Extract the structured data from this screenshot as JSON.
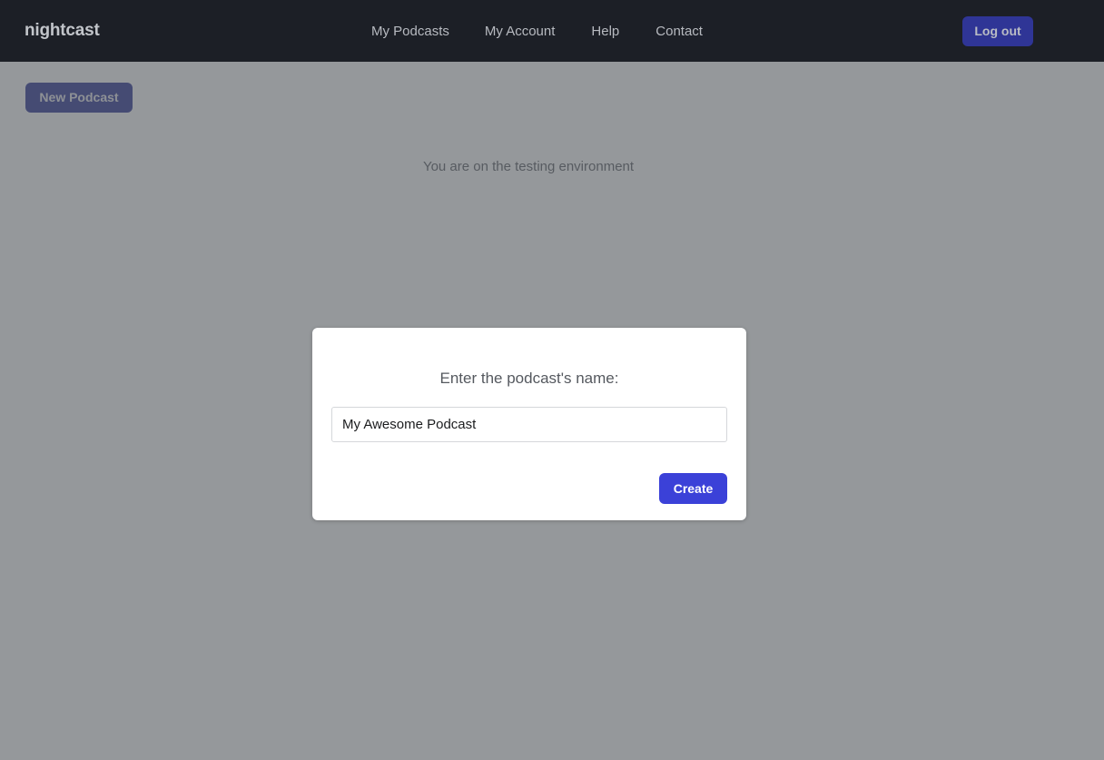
{
  "header": {
    "brand": "nightcast",
    "nav": [
      {
        "label": "My Podcasts"
      },
      {
        "label": "My Account"
      },
      {
        "label": "Help"
      },
      {
        "label": "Contact"
      }
    ],
    "logout_label": "Log out",
    "background_color": "#1c1f26",
    "button_color": "#2f3596"
  },
  "toolbar": {
    "new_podcast_label": "New Podcast"
  },
  "page": {
    "environment_notice": "You are on the testing environment"
  },
  "modal": {
    "title": "Enter the podcast's name:",
    "input_value": "My Awesome Podcast",
    "input_placeholder": "",
    "create_label": "Create",
    "create_color": "#3b41d8"
  }
}
